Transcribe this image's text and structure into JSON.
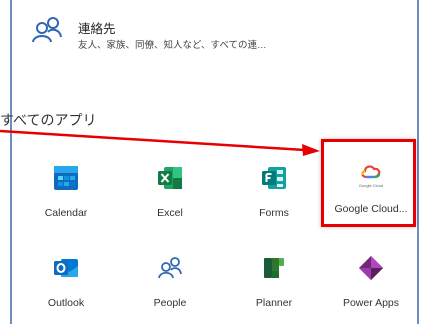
{
  "contacts": {
    "title": "連絡先",
    "description": "友人、家族、同僚、知人など、すべての連…"
  },
  "section": {
    "title": "すべてのアプリ"
  },
  "apps": [
    {
      "label": "Calendar",
      "icon": "calendar-icon"
    },
    {
      "label": "Excel",
      "icon": "excel-icon"
    },
    {
      "label": "Forms",
      "icon": "forms-icon"
    },
    {
      "label": "Google Cloud...",
      "icon": "google-cloud-icon"
    },
    {
      "label": "Outlook",
      "icon": "outlook-icon"
    },
    {
      "label": "People",
      "icon": "people-icon"
    },
    {
      "label": "Planner",
      "icon": "planner-icon"
    },
    {
      "label": "Power Apps",
      "icon": "power-apps-icon"
    }
  ],
  "colors": {
    "highlight": "#e60000",
    "border": "#6d8fbf",
    "people_blue": "#2f67b5",
    "excel_green": "#107c41",
    "forms_teal": "#037b7b",
    "planner_green": "#31752f",
    "powerapps_purple": "#742774"
  },
  "gc_tiny_text": "Google Cloud"
}
